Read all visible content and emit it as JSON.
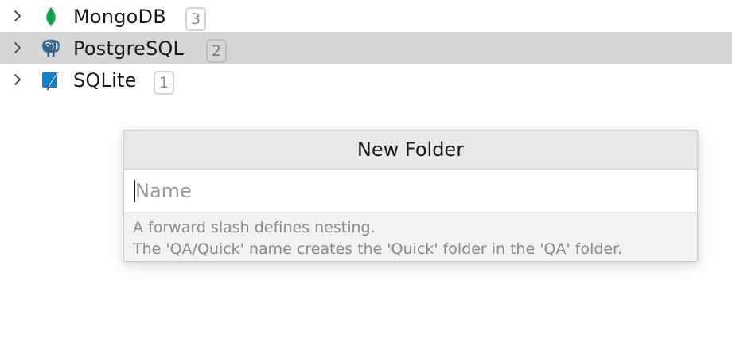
{
  "tree": {
    "items": [
      {
        "label": "MongoDB",
        "count": "3",
        "icon": "mongodb-leaf-icon",
        "selected": false
      },
      {
        "label": "PostgreSQL",
        "count": "2",
        "icon": "postgresql-elephant-icon",
        "selected": true
      },
      {
        "label": "SQLite",
        "count": "1",
        "icon": "sqlite-feather-icon",
        "selected": false
      }
    ]
  },
  "dialog": {
    "title": "New Folder",
    "name_value": "",
    "name_placeholder": "Name",
    "hint_line1": "A forward slash defines nesting.",
    "hint_line2": "The 'QA/Quick' name creates the 'Quick' folder in the 'QA' folder."
  },
  "colors": {
    "selected_row_bg": "#d6d6d6",
    "mongodb_green": "#13aa52",
    "postgresql_blue": "#336791",
    "sqlite_blue": "#0f80cc",
    "badge_border": "#d4d4d4",
    "hint_text": "#8a8a8a"
  }
}
